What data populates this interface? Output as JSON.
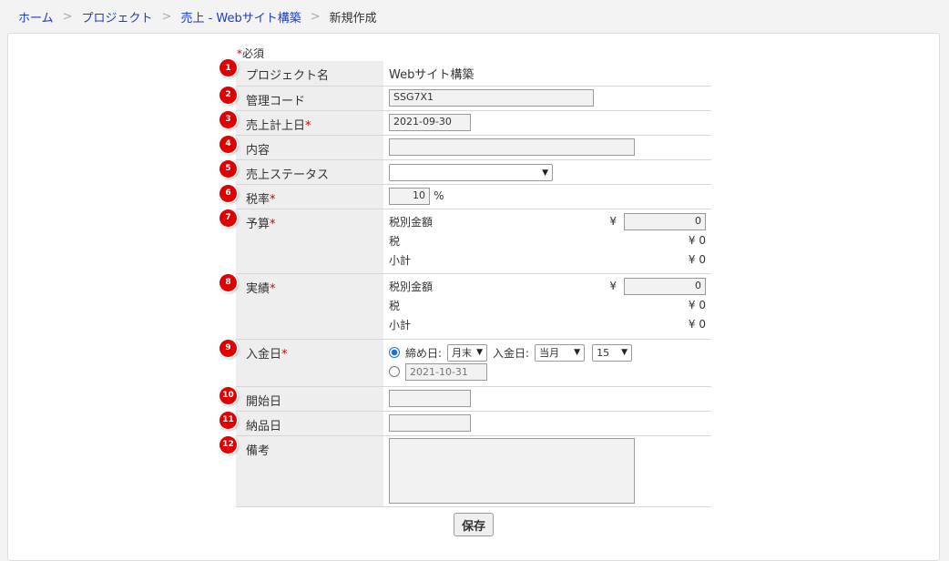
{
  "breadcrumb": {
    "home": "ホーム",
    "project": "プロジェクト",
    "sales": "売上 - Webサイト構築",
    "current": "新規作成",
    "sep": ">"
  },
  "required_note": {
    "star": "*",
    "text": "必須"
  },
  "fields": {
    "project_name": {
      "num": "1",
      "label": "プロジェクト名",
      "value": "Webサイト構築"
    },
    "code": {
      "num": "2",
      "label": "管理コード",
      "value": "SSG7X1"
    },
    "sales_date": {
      "num": "3",
      "label": "売上計上日",
      "value": "2021-09-30"
    },
    "content": {
      "num": "4",
      "label": "内容",
      "value": ""
    },
    "status": {
      "num": "5",
      "label": "売上ステータス",
      "value": ""
    },
    "tax_rate": {
      "num": "6",
      "label": "税率",
      "value": "10",
      "unit": "%"
    },
    "budget": {
      "num": "7",
      "label": "予算",
      "excl_label": "税別金額",
      "yen": "¥",
      "excl_value": "0",
      "tax_label": "税",
      "tax_value": "¥ 0",
      "subtotal_label": "小計",
      "subtotal_value": "¥ 0"
    },
    "actual": {
      "num": "8",
      "label": "実績",
      "excl_label": "税別金額",
      "yen": "¥",
      "excl_value": "0",
      "tax_label": "税",
      "tax_value": "¥ 0",
      "subtotal_label": "小計",
      "subtotal_value": "¥ 0"
    },
    "payment": {
      "num": "9",
      "label": "入金日",
      "closing_label": "締め日:",
      "closing_value": "月末",
      "pay_label": "入金日:",
      "month_value": "当月",
      "day_value": "15",
      "date_placeholder": "2021-10-31"
    },
    "start_date": {
      "num": "10",
      "label": "開始日",
      "value": ""
    },
    "delivery_date": {
      "num": "11",
      "label": "納品日",
      "value": ""
    },
    "notes": {
      "num": "12",
      "label": "備考",
      "value": ""
    }
  },
  "required_star": "*",
  "save_label": "保存",
  "colors": {
    "link": "#1a3cc8",
    "badge": "#e00000",
    "required": "#dd0000",
    "label_bg": "#eeeeee"
  }
}
